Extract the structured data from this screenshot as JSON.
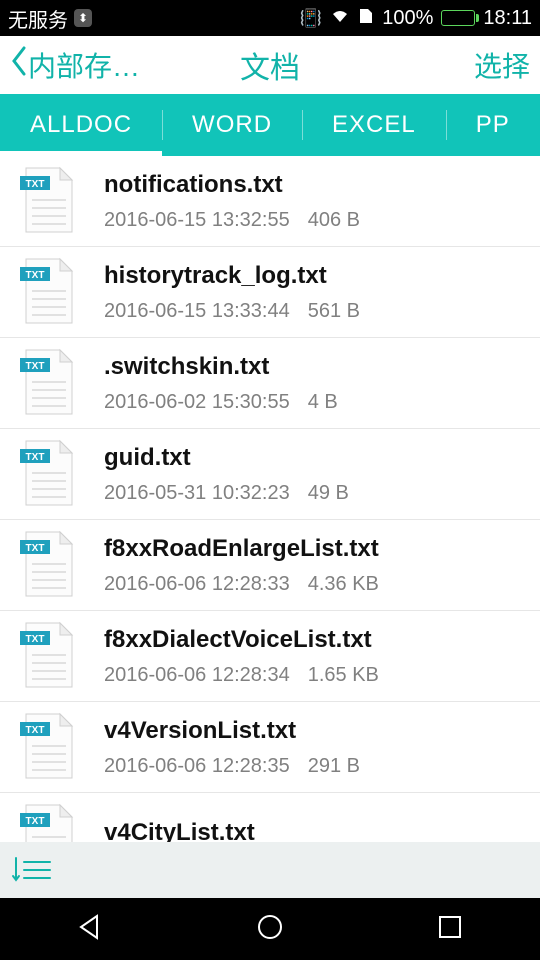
{
  "status": {
    "service_text": "无服务",
    "battery_text": "100%",
    "time": "18:11"
  },
  "header": {
    "back_label": "内部存…",
    "title": "文档",
    "select": "选择"
  },
  "tabs": {
    "items": [
      {
        "label": "ALLDOC",
        "active": true
      },
      {
        "label": "WORD",
        "active": false
      },
      {
        "label": "EXCEL",
        "active": false
      },
      {
        "label": "PP",
        "active": false
      }
    ]
  },
  "files": [
    {
      "name": "notifications.txt",
      "date": "2016-06-15 13:32:55",
      "size": "406 B"
    },
    {
      "name": "historytrack_log.txt",
      "date": "2016-06-15 13:33:44",
      "size": "561 B"
    },
    {
      "name": ".switchskin.txt",
      "date": "2016-06-02 15:30:55",
      "size": "4 B"
    },
    {
      "name": "guid.txt",
      "date": "2016-05-31 10:32:23",
      "size": "49 B"
    },
    {
      "name": "f8xxRoadEnlargeList.txt",
      "date": "2016-06-06 12:28:33",
      "size": "4.36 KB"
    },
    {
      "name": "f8xxDialectVoiceList.txt",
      "date": "2016-06-06 12:28:34",
      "size": "1.65 KB"
    },
    {
      "name": "v4VersionList.txt",
      "date": "2016-06-06 12:28:35",
      "size": "291 B"
    },
    {
      "name": "v4CityList.txt",
      "date": "",
      "size": ""
    }
  ]
}
